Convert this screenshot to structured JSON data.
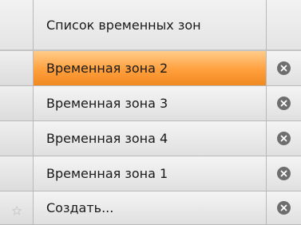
{
  "header": {
    "title": "Список временных зон"
  },
  "rows": [
    {
      "label": "Временная зона 2",
      "selected": true,
      "delete_icon": "remove-icon"
    },
    {
      "label": "Временная зона 3",
      "selected": false,
      "delete_icon": "remove-icon"
    },
    {
      "label": "Временная зона 4",
      "selected": false,
      "delete_icon": "remove-icon"
    },
    {
      "label": "Временная зона 1",
      "selected": false,
      "delete_icon": "remove-icon"
    }
  ],
  "new_row": {
    "label": "Создать...",
    "marker_icon": "star-icon",
    "delete_icon": "remove-icon"
  },
  "colors": {
    "selected_row": "#ff9f3c",
    "grid_line": "#b9b9b9",
    "delete_icon": "#6e6e6e"
  }
}
